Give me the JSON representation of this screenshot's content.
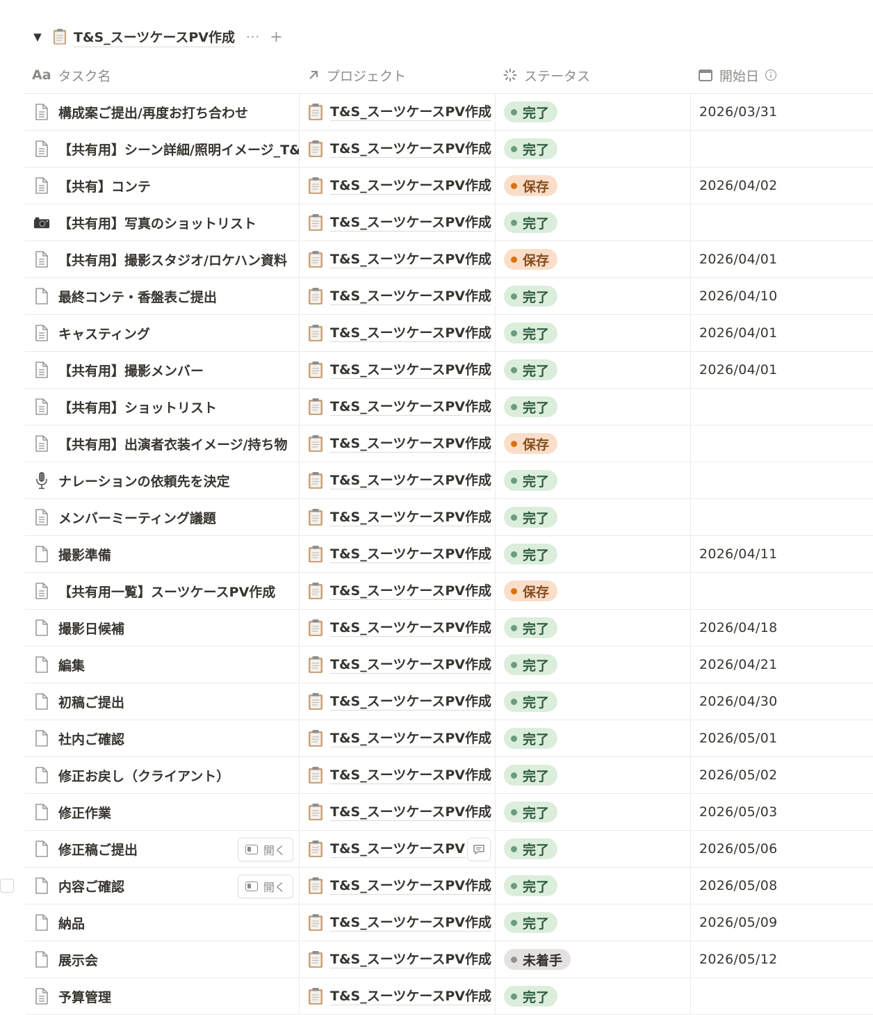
{
  "group": {
    "title": "T&S_スーツケースPV作成",
    "more": "···",
    "add": "+"
  },
  "columns": {
    "name": "タスク名",
    "name_icon_text": "Aa",
    "project": "プロジェクト",
    "status": "ステータス",
    "start": "開始日"
  },
  "open_label": "開く",
  "colors": {
    "done_bg": "#dbeddb",
    "done_text": "#2b593f",
    "done_dot": "#6c9b7d",
    "hold_bg": "#fadec9",
    "hold_text": "#854c1d",
    "hold_dot": "#d9730d",
    "todo_bg": "#e3e2e0",
    "todo_text": "#32302c",
    "todo_dot": "#91918e"
  },
  "rows": [
    {
      "name": "構成案ご提出/再度お打ち合わせ",
      "icon": "page-lines-icon",
      "project": "T&S_スーツケースPV作成",
      "status": "完了",
      "status_kind": "done",
      "date": "2026/03/31"
    },
    {
      "name": "【共有用】シーン詳細/照明イメージ_T&",
      "icon": "page-lines-icon",
      "project": "T&S_スーツケースPV作成",
      "status": "完了",
      "status_kind": "done",
      "date": ""
    },
    {
      "name": "【共有】コンテ",
      "icon": "page-lines-icon",
      "project": "T&S_スーツケースPV作成",
      "status": "保存",
      "status_kind": "hold",
      "date": "2026/04/02"
    },
    {
      "name": "【共有用】写真のショットリスト",
      "icon": "camera-icon",
      "project": "T&S_スーツケースPV作成",
      "status": "完了",
      "status_kind": "done",
      "date": ""
    },
    {
      "name": "【共有用】撮影スタジオ/ロケハン資料",
      "icon": "page-lines-icon",
      "project": "T&S_スーツケースPV作成",
      "status": "保存",
      "status_kind": "hold",
      "date": "2026/04/01"
    },
    {
      "name": "最終コンテ・香盤表ご提出",
      "icon": "page-icon",
      "project": "T&S_スーツケースPV作成",
      "status": "完了",
      "status_kind": "done",
      "date": "2026/04/10"
    },
    {
      "name": "キャスティング",
      "icon": "page-lines-icon",
      "project": "T&S_スーツケースPV作成",
      "status": "完了",
      "status_kind": "done",
      "date": "2026/04/01"
    },
    {
      "name": "【共有用】撮影メンバー",
      "icon": "page-lines-icon",
      "project": "T&S_スーツケースPV作成",
      "status": "完了",
      "status_kind": "done",
      "date": "2026/04/01"
    },
    {
      "name": "【共有用】ショットリスト",
      "icon": "page-lines-icon",
      "project": "T&S_スーツケースPV作成",
      "status": "完了",
      "status_kind": "done",
      "date": ""
    },
    {
      "name": "【共有用】出演者衣装イメージ/持ち物",
      "icon": "page-lines-icon",
      "project": "T&S_スーツケースPV作成",
      "status": "保存",
      "status_kind": "hold",
      "date": ""
    },
    {
      "name": "ナレーションの依頼先を決定",
      "icon": "microphone-icon",
      "project": "T&S_スーツケースPV作成",
      "status": "完了",
      "status_kind": "done",
      "date": ""
    },
    {
      "name": "メンバーミーティング議題",
      "icon": "page-lines-icon",
      "project": "T&S_スーツケースPV作成",
      "status": "完了",
      "status_kind": "done",
      "date": ""
    },
    {
      "name": "撮影準備",
      "icon": "page-icon",
      "project": "T&S_スーツケースPV作成",
      "status": "完了",
      "status_kind": "done",
      "date": "2026/04/11"
    },
    {
      "name": "【共有用一覧】スーツケースPV作成",
      "icon": "page-lines-icon",
      "project": "T&S_スーツケースPV作成",
      "status": "保存",
      "status_kind": "hold",
      "date": ""
    },
    {
      "name": "撮影日候補",
      "icon": "page-icon",
      "project": "T&S_スーツケースPV作成",
      "status": "完了",
      "status_kind": "done",
      "date": "2026/04/18"
    },
    {
      "name": "編集",
      "icon": "page-icon",
      "project": "T&S_スーツケースPV作成",
      "status": "完了",
      "status_kind": "done",
      "date": "2026/04/21"
    },
    {
      "name": "初稿ご提出",
      "icon": "page-icon",
      "project": "T&S_スーツケースPV作成",
      "status": "完了",
      "status_kind": "done",
      "date": "2026/04/30"
    },
    {
      "name": "社内ご確認",
      "icon": "page-icon",
      "project": "T&S_スーツケースPV作成",
      "status": "完了",
      "status_kind": "done",
      "date": "2026/05/01"
    },
    {
      "name": "修正お戻し（クライアント）",
      "icon": "page-icon",
      "project": "T&S_スーツケースPV作成",
      "status": "完了",
      "status_kind": "done",
      "date": "2026/05/02"
    },
    {
      "name": "修正作業",
      "icon": "page-icon",
      "project": "T&S_スーツケースPV作成",
      "status": "完了",
      "status_kind": "done",
      "date": "2026/05/03"
    },
    {
      "name": "修正稿ご提出",
      "icon": "page-icon",
      "project": "T&S_スーツケースPV",
      "status": "完了",
      "status_kind": "done",
      "date": "2026/05/06",
      "open_button": true,
      "comment_button": true
    },
    {
      "name": "内容ご確認",
      "icon": "page-icon",
      "project": "T&S_スーツケースPV作成",
      "status": "完了",
      "status_kind": "done",
      "date": "2026/05/08",
      "open_button": true,
      "checkbox": true
    },
    {
      "name": "納品",
      "icon": "page-icon",
      "project": "T&S_スーツケースPV作成",
      "status": "完了",
      "status_kind": "done",
      "date": "2026/05/09"
    },
    {
      "name": "展示会",
      "icon": "page-icon",
      "project": "T&S_スーツケースPV作成",
      "status": "未着手",
      "status_kind": "todo",
      "date": "2026/05/12"
    },
    {
      "name": "予算管理",
      "icon": "page-lines-icon",
      "project": "T&S_スーツケースPV作成",
      "status": "完了",
      "status_kind": "done",
      "date": ""
    }
  ]
}
